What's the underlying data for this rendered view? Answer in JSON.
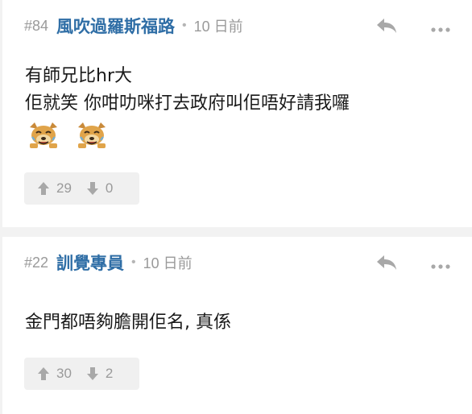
{
  "posts": [
    {
      "number": "#84",
      "username": "風吹過羅斯福路",
      "separator": "•",
      "timestamp": "10 日前",
      "content_lines": [
        "有師兄比hr大",
        "佢就笑 你咁叻咪打去政府叫佢唔好請我囉"
      ],
      "emojis": [
        "laughing-dog-emoji",
        "laughing-dog-emoji"
      ],
      "upvotes": "29",
      "downvotes": "0",
      "icons": {
        "reply": "reply-icon",
        "more": "more-icon",
        "up": "thumb-up-arrow-icon",
        "down": "thumb-down-arrow-icon"
      }
    },
    {
      "number": "#22",
      "username": "訓覺專員",
      "separator": "•",
      "timestamp": "10 日前",
      "content_lines": [
        "金門都唔夠膽開佢名, 真係"
      ],
      "emojis": [],
      "upvotes": "30",
      "downvotes": "2",
      "icons": {
        "reply": "reply-icon",
        "more": "more-icon",
        "up": "thumb-up-arrow-icon",
        "down": "thumb-down-arrow-icon"
      }
    }
  ],
  "colors": {
    "username": "#2f6ea6",
    "meta": "#9a9a9a",
    "background": "#f2f2f2",
    "card": "#ffffff",
    "vote_box": "#f0f0f0"
  }
}
